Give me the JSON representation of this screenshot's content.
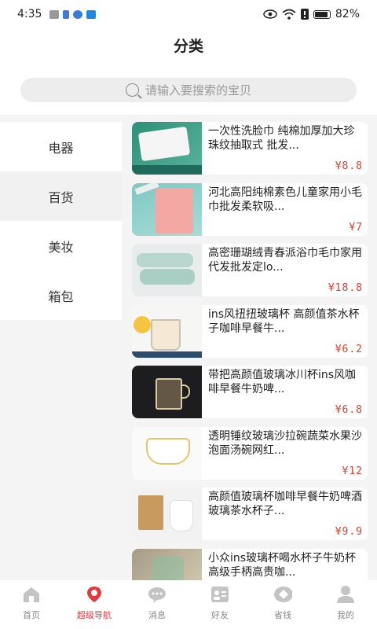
{
  "status": {
    "time": "4:35",
    "battery": "82%"
  },
  "header": {
    "title": "分类"
  },
  "search": {
    "placeholder": "请输入要搜索的宝贝"
  },
  "categories": [
    {
      "label": "电器",
      "active": false
    },
    {
      "label": "百货",
      "active": true
    },
    {
      "label": "美妆",
      "active": false
    },
    {
      "label": "箱包",
      "active": false
    }
  ],
  "products": [
    {
      "name": "一次性洗脸巾  纯棉加厚加大珍珠纹抽取式  批发...",
      "price": "¥8.8"
    },
    {
      "name": "河北高阳纯棉素色儿童家用小毛巾批发柔软吸...",
      "price": "¥7"
    },
    {
      "name": "高密珊瑚绒青春派浴巾毛巾家用代发批发定lo...",
      "price": "¥18.8"
    },
    {
      "name": "ins风扭扭玻璃杯  高颜值茶水杯子咖啡早餐牛...",
      "price": "¥6.2"
    },
    {
      "name": "带把高颜值玻璃冰川杯ins风咖啡早餐牛奶啤...",
      "price": "¥6.8"
    },
    {
      "name": "透明锤纹玻璃沙拉碗蔬菜水果沙泡面汤碗网红...",
      "price": "¥12"
    },
    {
      "name": "高颜值玻璃杯咖啡早餐牛奶啤酒玻璃茶水杯子...",
      "price": "¥9.9"
    },
    {
      "name": "小众ins玻璃杯喝水杯子牛奶杯高级手柄高贵咖...",
      "price": ""
    }
  ],
  "tabs": [
    {
      "label": "首页",
      "icon": "home-icon"
    },
    {
      "label": "超级导航",
      "icon": "location-icon",
      "active": true
    },
    {
      "label": "消息",
      "icon": "message-icon"
    },
    {
      "label": "好友",
      "icon": "friends-icon"
    },
    {
      "label": "省钱",
      "icon": "savings-icon"
    },
    {
      "label": "我的",
      "icon": "profile-icon"
    }
  ],
  "colors": {
    "accent": "#e4393c",
    "price": "#e23c2e"
  }
}
